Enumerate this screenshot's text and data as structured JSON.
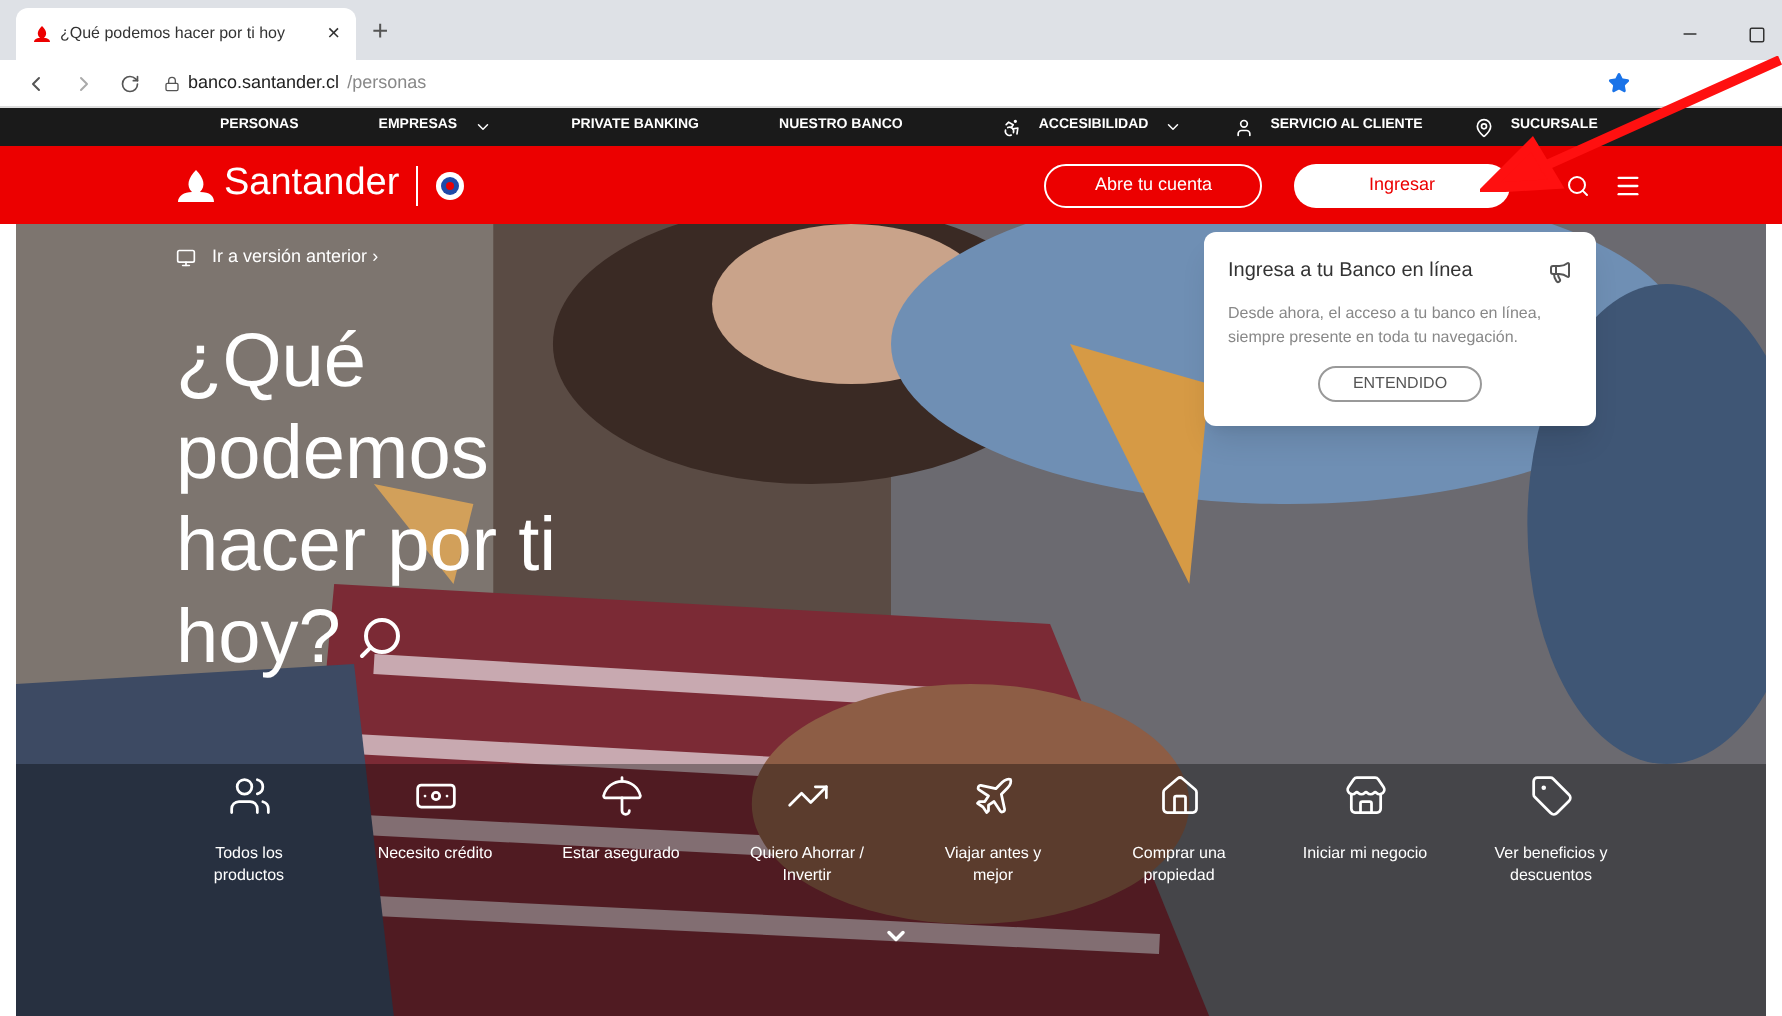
{
  "browser": {
    "tab_title": "¿Qué podemos hacer por ti hoy",
    "tab_close": "×",
    "new_tab": "+",
    "url_host": "banco.santander.cl",
    "url_path": "/personas"
  },
  "top_nav": [
    {
      "label": "PERSONAS",
      "kind": "link"
    },
    {
      "label": "EMPRESAS",
      "kind": "dropdown"
    },
    {
      "label": "PRIVATE BANKING",
      "kind": "link"
    },
    {
      "label": "NUESTRO BANCO",
      "kind": "link"
    }
  ],
  "top_nav_right": [
    {
      "label": "ACCESIBILIDAD",
      "kind": "accessibility"
    },
    {
      "label": "SERVICIO AL CLIENTE",
      "kind": "user"
    },
    {
      "label": "SUCURSALE",
      "kind": "pin"
    }
  ],
  "header": {
    "brand": "Santander",
    "open_account": "Abre tu cuenta",
    "login": "Ingresar"
  },
  "hero": {
    "back_link": "Ir a versión anterior",
    "back_arrow": "›",
    "heading": [
      "¿Qué",
      "podemos",
      "hacer por ti",
      "hoy?"
    ]
  },
  "popup": {
    "title": "Ingresa a tu Banco en línea",
    "body": "Desde ahora, el acceso a tu banco en línea, siempre presente en toda tu navegación.",
    "button": "ENTENDIDO"
  },
  "shortcuts": [
    {
      "label": "Todos los productos",
      "kind": "people"
    },
    {
      "label": "Necesito crédito",
      "kind": "money"
    },
    {
      "label": "Estar asegurado",
      "kind": "umbrella"
    },
    {
      "label": "Quiero Ahorrar / Invertir",
      "kind": "chart"
    },
    {
      "label": "Viajar antes y mejor",
      "kind": "plane"
    },
    {
      "label": "Comprar una propiedad",
      "kind": "house"
    },
    {
      "label": "Iniciar mi negocio",
      "kind": "store"
    },
    {
      "label": "Ver beneficios y descuentos",
      "kind": "tag"
    }
  ]
}
